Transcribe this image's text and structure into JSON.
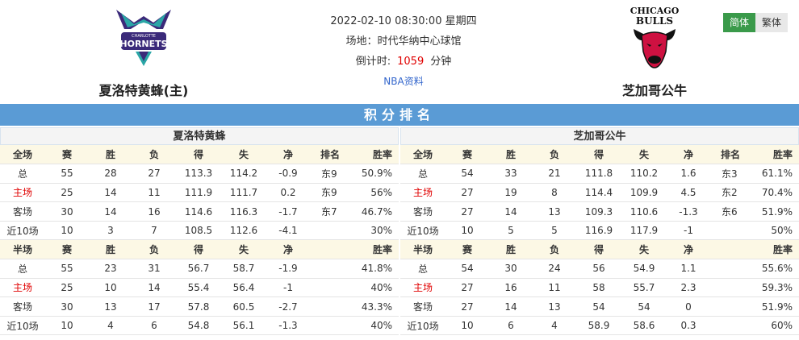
{
  "header": {
    "home": {
      "name": "夏洛特黄蜂(主)",
      "logo_icon": "hornets-logo-icon",
      "logo_wordmark": "HORNETS",
      "logo_city": "CHARLOTTE"
    },
    "away": {
      "name": "芝加哥公牛",
      "logo_icon": "bulls-logo-icon",
      "logo_line1": "CHICAGO",
      "logo_line2": "BULLS"
    },
    "datetime": "2022-02-10 08:30:00 星期四",
    "venue": "场地：时代华纳中心球馆",
    "countdown_label": "倒计时:",
    "countdown_value": "1059",
    "countdown_unit": "分钟",
    "nba_link": "NBA资料"
  },
  "lang": {
    "simplified": "简体",
    "traditional": "繁体"
  },
  "standings": {
    "title": "积分排名",
    "home": {
      "team": "夏洛特黄蜂",
      "full_header": [
        "全场",
        "赛",
        "胜",
        "负",
        "得",
        "失",
        "净",
        "排名",
        "胜率"
      ],
      "full_rows": [
        [
          "总",
          "55",
          "28",
          "27",
          "113.3",
          "114.2",
          "-0.9",
          "东9",
          "50.9%"
        ],
        [
          "主场",
          "25",
          "14",
          "11",
          "111.9",
          "111.7",
          "0.2",
          "东9",
          "56%"
        ],
        [
          "客场",
          "30",
          "14",
          "16",
          "114.6",
          "116.3",
          "-1.7",
          "东7",
          "46.7%"
        ],
        [
          "近10场",
          "10",
          "3",
          "7",
          "108.5",
          "112.6",
          "-4.1",
          "",
          "30%"
        ]
      ],
      "half_header": [
        "半场",
        "赛",
        "胜",
        "负",
        "得",
        "失",
        "净",
        "",
        "胜率"
      ],
      "half_rows": [
        [
          "总",
          "55",
          "23",
          "31",
          "56.7",
          "58.7",
          "-1.9",
          "",
          "41.8%"
        ],
        [
          "主场",
          "25",
          "10",
          "14",
          "55.4",
          "56.4",
          "-1",
          "",
          "40%"
        ],
        [
          "客场",
          "30",
          "13",
          "17",
          "57.8",
          "60.5",
          "-2.7",
          "",
          "43.3%"
        ],
        [
          "近10场",
          "10",
          "4",
          "6",
          "54.8",
          "56.1",
          "-1.3",
          "",
          "40%"
        ]
      ]
    },
    "away": {
      "team": "芝加哥公牛",
      "full_header": [
        "全场",
        "赛",
        "胜",
        "负",
        "得",
        "失",
        "净",
        "排名",
        "胜率"
      ],
      "full_rows": [
        [
          "总",
          "54",
          "33",
          "21",
          "111.8",
          "110.2",
          "1.6",
          "东3",
          "61.1%"
        ],
        [
          "主场",
          "27",
          "19",
          "8",
          "114.4",
          "109.9",
          "4.5",
          "东2",
          "70.4%"
        ],
        [
          "客场",
          "27",
          "14",
          "13",
          "109.3",
          "110.6",
          "-1.3",
          "东6",
          "51.9%"
        ],
        [
          "近10场",
          "10",
          "5",
          "5",
          "116.9",
          "117.9",
          "-1",
          "",
          "50%"
        ]
      ],
      "half_header": [
        "半场",
        "赛",
        "胜",
        "负",
        "得",
        "失",
        "净",
        "",
        "胜率"
      ],
      "half_rows": [
        [
          "总",
          "54",
          "30",
          "24",
          "56",
          "54.9",
          "1.1",
          "",
          "55.6%"
        ],
        [
          "主场",
          "27",
          "16",
          "11",
          "58",
          "55.7",
          "2.3",
          "",
          "59.3%"
        ],
        [
          "客场",
          "27",
          "14",
          "13",
          "54",
          "54",
          "0",
          "",
          "51.9%"
        ],
        [
          "近10场",
          "10",
          "6",
          "4",
          "58.9",
          "58.6",
          "0.3",
          "",
          "60%"
        ]
      ]
    }
  },
  "colors": {
    "accent_blue": "#5a9bd5",
    "highlight_red": "#e00000",
    "lang_active": "#3a9a4a",
    "table_head": "#fcf8e5"
  }
}
